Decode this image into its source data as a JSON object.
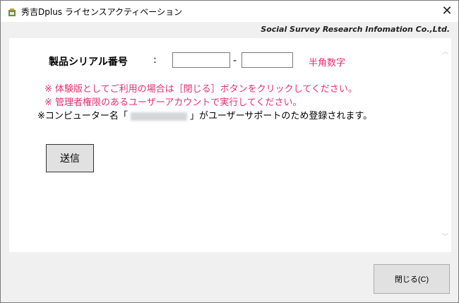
{
  "window": {
    "title": "秀吉Dplus ライセンスアクティベーション",
    "close_glyph": "✕",
    "icon": "app-icon"
  },
  "header": {
    "company": "Social Survey Research Infomation Co.,Ltd."
  },
  "form": {
    "serial_label": "製品シリアル番号",
    "colon": ":",
    "serial_part1": "",
    "serial_part2": "",
    "dash": "-",
    "hint": "半角数字",
    "note1": "※ 体験版としてご利用の場合は［閉じる］ボタンをクリックしてください。",
    "note2": "※ 管理者権限のあるユーザーアカウントで実行してください。",
    "note3_prefix": "※コンピューター名「",
    "note3_suffix": "」がユーザーサポートのため登録されます。",
    "send_label": "送信"
  },
  "scroll": {
    "up_glyph": "︿",
    "down_glyph": "﹀"
  },
  "footer": {
    "close_label": "閉じる(C)"
  }
}
